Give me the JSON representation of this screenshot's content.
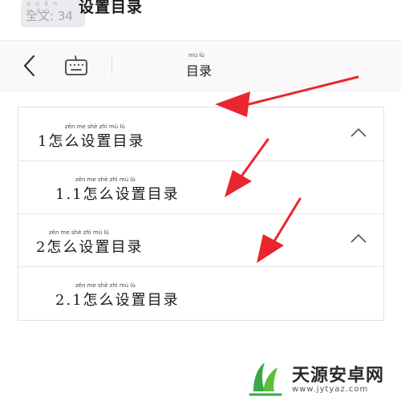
{
  "header": {
    "word_count_pinyin": "quán wén",
    "word_count": "全文: 34",
    "doc_title": "设置目录"
  },
  "navbar": {
    "title_pinyin": "mù lù",
    "title": "目录"
  },
  "toc": {
    "items": [
      {
        "pinyin": "zěn   me   shè   zhì   mù   lù",
        "label": "1怎么设置目录",
        "level": 1,
        "expanded": true
      },
      {
        "pinyin": "zěn   me   shè   zhì   mù   lù",
        "label": "1.1怎么设置目录",
        "level": 2
      },
      {
        "pinyin": "zěn   me   shè   zhì   mù   lù",
        "label": "2怎么设置目录",
        "level": 1,
        "expanded": true
      },
      {
        "pinyin": "zěn   me   shè   zhì   mù   lù",
        "label": "2.1怎么设置目录",
        "level": 2
      }
    ]
  },
  "watermark": {
    "name": "天源安卓网",
    "url": "www.jytyaz.com"
  },
  "colors": {
    "annotation_arrow": "#e8262d",
    "watermark_leaf": "#3aa845"
  }
}
